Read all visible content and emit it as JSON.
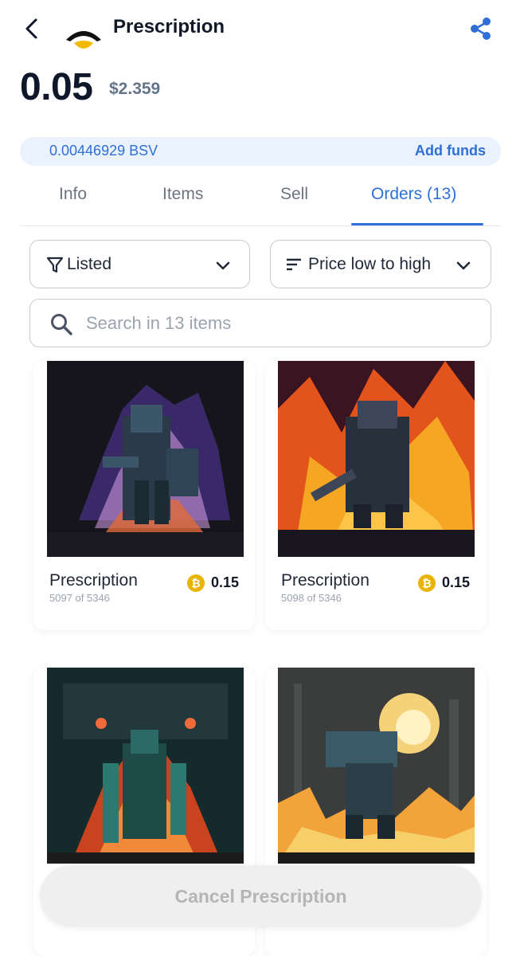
{
  "header": {
    "title": "Prescription",
    "back_icon": "chevron-left-icon",
    "share_icon": "share-icon"
  },
  "price": {
    "amount": "0.05",
    "usd": "$2.359"
  },
  "balance": {
    "amount": "0.00446929 BSV",
    "add_funds_label": "Add funds"
  },
  "tabs": [
    {
      "label": "Info",
      "active": false
    },
    {
      "label": "Items",
      "active": false
    },
    {
      "label": "Sell",
      "active": false
    },
    {
      "label": "Orders (13)",
      "active": true
    }
  ],
  "filters": {
    "status": {
      "label": "Listed",
      "icon": "filter-icon"
    },
    "sort": {
      "label": "Price low to high",
      "icon": "sort-icon"
    }
  },
  "search": {
    "placeholder": "Search in 13 items"
  },
  "items": [
    {
      "name": "Prescription",
      "edition": "5097 of 5346",
      "price": "0.15"
    },
    {
      "name": "Prescription",
      "edition": "5098 of 5346",
      "price": "0.15"
    },
    {
      "name": "",
      "edition": "",
      "price": ""
    },
    {
      "name": "",
      "edition": "",
      "price": ""
    }
  ],
  "footer": {
    "cancel_label": "Cancel Prescription"
  },
  "colors": {
    "accent": "#2f6fd6",
    "coin": "#eab308",
    "balance_bg": "#eaf2fd"
  }
}
